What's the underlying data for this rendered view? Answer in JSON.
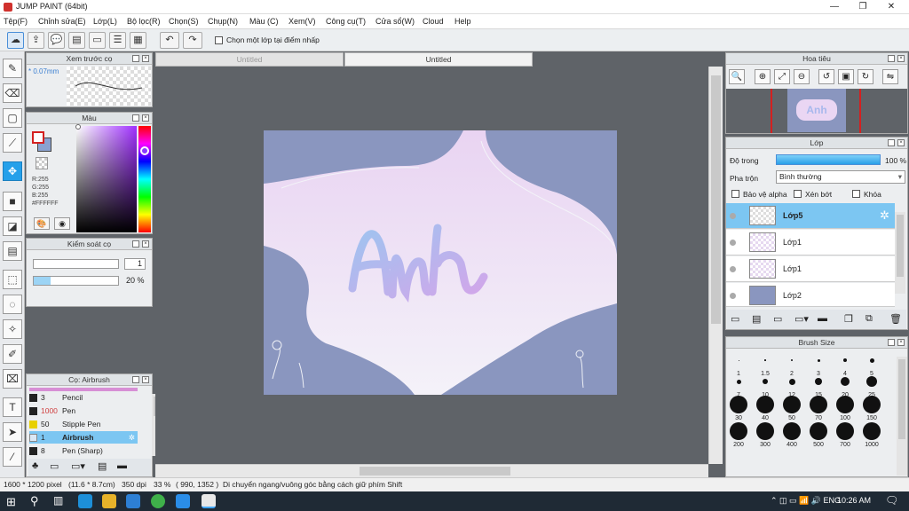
{
  "window": {
    "title": "JUMP PAINT (64bit)",
    "min": "—",
    "max": "❐",
    "close": "✕"
  },
  "menu": [
    "Tệp(F)",
    "Chỉnh sửa(E)",
    "Lớp(L)",
    "Bộ lọc(R)",
    "Chọn(S)",
    "Chụp(N)",
    "Màu (C)",
    "Xem(V)",
    "Công cụ(T)",
    "Cửa sổ(W)",
    "Cloud",
    "Help"
  ],
  "toolbar": {
    "checkbox_label": "Chọn một lớp tại điểm nhấp"
  },
  "brush_preview": {
    "title": "Xem trước cọ",
    "size": "* 0.07mm"
  },
  "color_panel": {
    "title": "Màu",
    "r": "R:255",
    "g": "G:255",
    "b": "B:255",
    "hex": "#FFFFFF"
  },
  "brush_control": {
    "title": "Kiểm soát cọ",
    "size_value": "1",
    "opacity_value": "20 %"
  },
  "brush_list": {
    "title": "Cọ: Airbrush",
    "items": [
      {
        "size": "3",
        "name": "Pencil",
        "color": "#222222"
      },
      {
        "size": "1000",
        "name": "Pen",
        "color": "#222222"
      },
      {
        "size": "50",
        "name": "Stipple Pen",
        "color": "#e8d000"
      },
      {
        "size": "1",
        "name": "Airbrush",
        "color": "#dbe8f5"
      },
      {
        "size": "8",
        "name": "Pen (Sharp)",
        "color": "#222222"
      }
    ]
  },
  "tabs": {
    "tab1": "Untitled",
    "tab2": "Untitled"
  },
  "artwork": {
    "text": "Anh"
  },
  "navigator": {
    "title": "Hoa tiêu",
    "thumb_text": "Anh"
  },
  "layers": {
    "title": "Lớp",
    "opacity_label": "Độ trong",
    "opacity_value": "100 %",
    "blend_label": "Pha trộn",
    "blend_value": "Bình thường",
    "protect_alpha": "Bảo vệ alpha",
    "clip": "Xén bớt",
    "lock": "Khóa",
    "items": [
      {
        "name": "Lớp5",
        "selected": true
      },
      {
        "name": "Lớp1",
        "selected": false
      },
      {
        "name": "Lớp1",
        "selected": false
      },
      {
        "name": "Lớp2",
        "selected": false
      }
    ]
  },
  "brush_size": {
    "title": "Brush Size",
    "sizes": [
      "1",
      "1.5",
      "2",
      "3",
      "4",
      "5",
      "7",
      "10",
      "12",
      "15",
      "20",
      "25",
      "30",
      "40",
      "50",
      "70",
      "100",
      "150",
      "200",
      "300",
      "400",
      "500",
      "700",
      "1000"
    ]
  },
  "status": {
    "dimensions": "1600 * 1200 pixel",
    "physical": "(11.6 * 8.7cm)",
    "dpi": "350 dpi",
    "zoom": "33 %",
    "coords": "( 990, 1352 )",
    "hint": "Di chuyển ngang/vuông góc bằng cách giữ phím Shift"
  },
  "taskbar": {
    "time": "10:26 AM"
  },
  "colors": {
    "accent": "#24a0ea",
    "selection": "#7cc6f2",
    "art_bg": "#8a96bf"
  }
}
